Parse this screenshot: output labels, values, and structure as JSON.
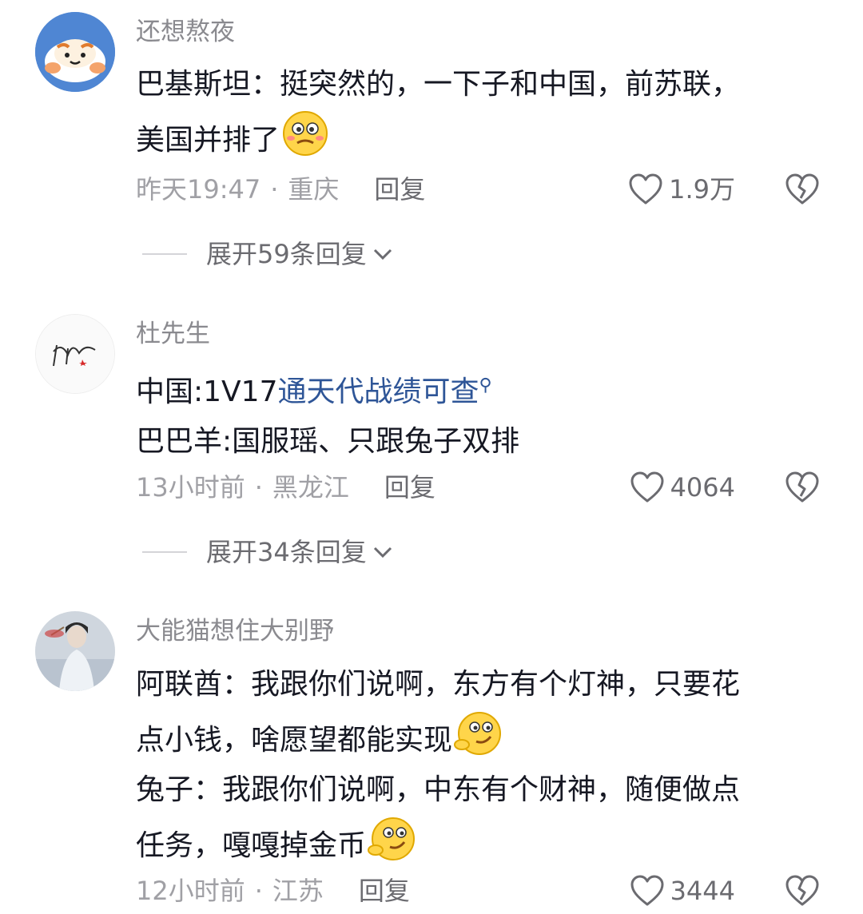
{
  "comments": [
    {
      "username": "还想熬夜",
      "lines": [
        "巴基斯坦：挺突然的，一下子和中国，前苏联，",
        "美国并排了"
      ],
      "time": "昨天19:47",
      "location": "重庆",
      "reply_label": "回复",
      "likes": "1.9万",
      "expand_label": "展开59条回复"
    },
    {
      "username": "杜先生",
      "line1_prefix": "中国:1V17",
      "hashtag": "通天代战绩可查",
      "lines": [
        "巴巴羊:国服瑶、只跟兔子双排"
      ],
      "time": "13小时前",
      "location": "黑龙江",
      "reply_label": "回复",
      "likes": "4064",
      "expand_label": "展开34条回复"
    },
    {
      "username": "大能猫想住大别野",
      "lines": [
        "阿联酋：我跟你们说啊，东方有个灯神，只要花",
        "点小钱，啥愿望都能实现",
        "兔子：我跟你们说啊，中东有个财神，随便做点",
        "任务，嘎嘎掉金币"
      ],
      "time": "12小时前",
      "location": "江苏",
      "reply_label": "回复",
      "likes": "3444"
    }
  ],
  "meta_separator": "·",
  "icons": {
    "like": "heart-outline-icon",
    "dislike": "broken-heart-icon",
    "expand": "chevron-down-icon",
    "search": "search-icon",
    "emoji_1": "nervous-face-emoji",
    "emoji_2": "smirk-face-emoji"
  },
  "colors": {
    "hashtag": "#2e5597",
    "username": "#8a8a8f",
    "meta": "#a0a0a5"
  }
}
